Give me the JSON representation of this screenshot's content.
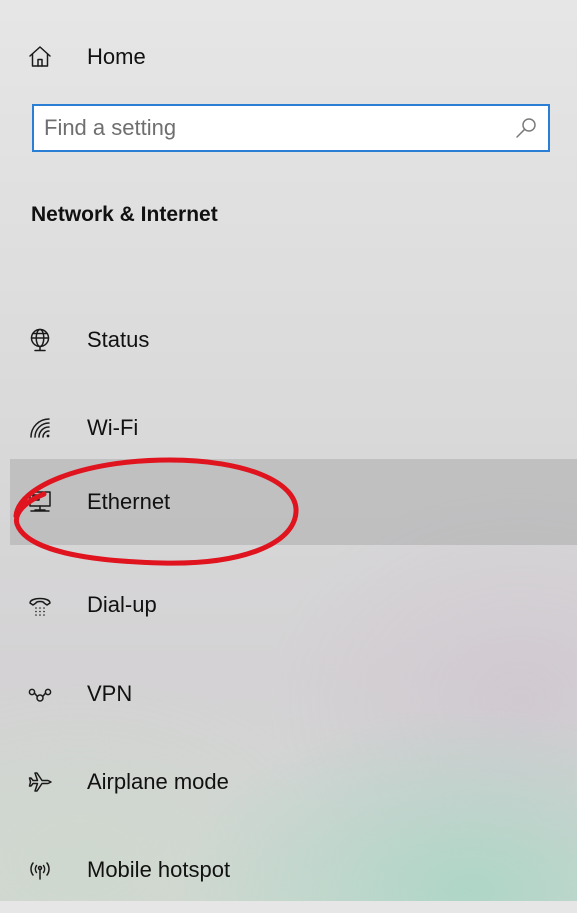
{
  "home": {
    "label": "Home",
    "icon": "home-icon"
  },
  "search": {
    "value": "",
    "placeholder": "Find a setting",
    "icon": "search-icon"
  },
  "section": {
    "title": "Network & Internet"
  },
  "nav": {
    "selected": "Ethernet",
    "items": [
      {
        "label": "Status",
        "icon": "globe-status-icon"
      },
      {
        "label": "Wi-Fi",
        "icon": "wifi-icon"
      },
      {
        "label": "Ethernet",
        "icon": "ethernet-icon"
      },
      {
        "label": "Dial-up",
        "icon": "dialup-icon"
      },
      {
        "label": "VPN",
        "icon": "vpn-icon"
      },
      {
        "label": "Airplane mode",
        "icon": "airplane-icon"
      },
      {
        "label": "Mobile hotspot",
        "icon": "hotspot-icon"
      }
    ]
  },
  "colors": {
    "accent": "#2a7fd4",
    "annotation": "#e0141e",
    "selected_background": "#b8b8b8"
  }
}
